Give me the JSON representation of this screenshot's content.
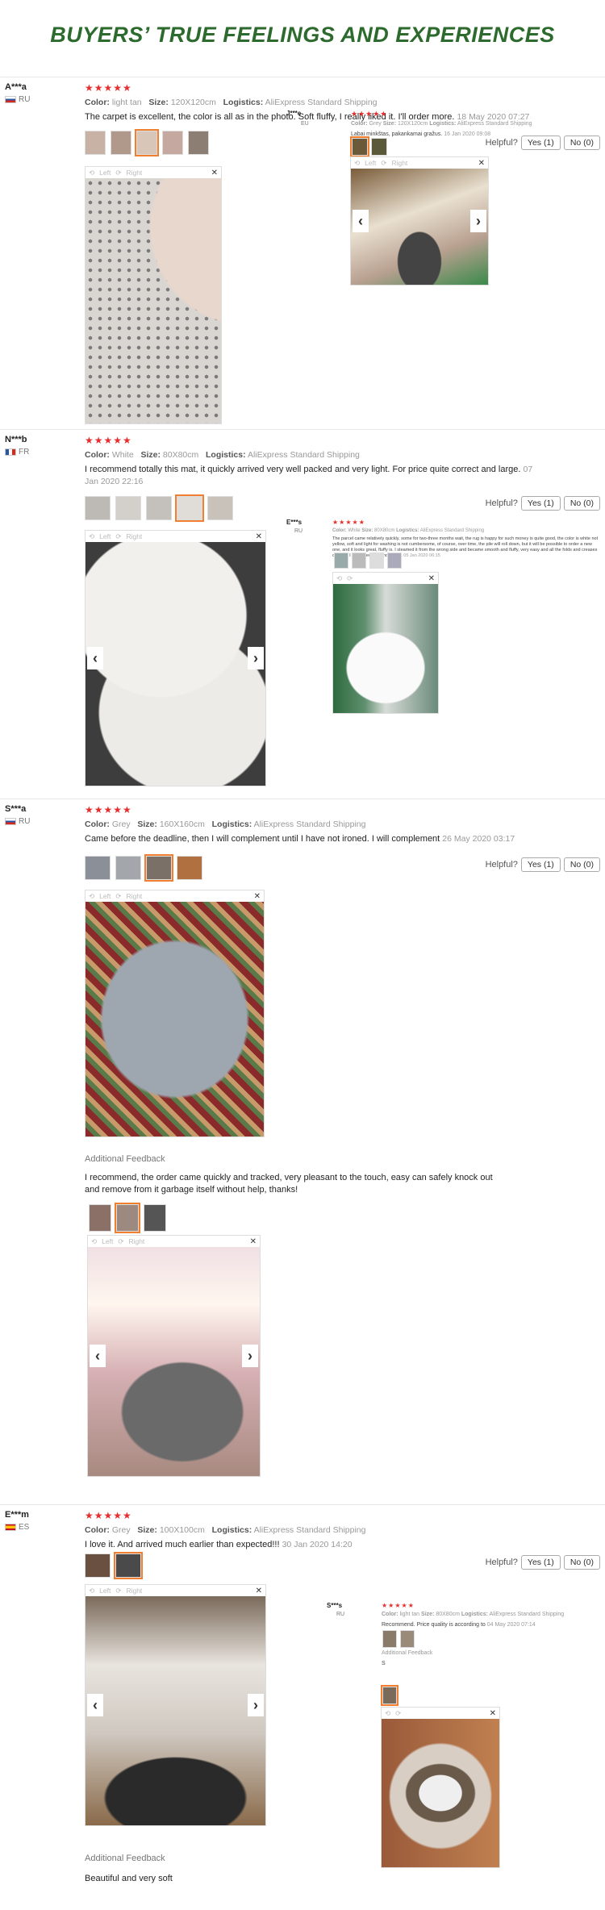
{
  "heading": "BUYERS’ TRUE FEELINGS AND EXPERIENCES",
  "labels": {
    "color": "Color:",
    "size": "Size:",
    "logistics": "Logistics:",
    "helpful": "Helpful?",
    "yes": "Yes (1)",
    "no": "No (0)",
    "left": "Left",
    "right": "Right",
    "additional": "Additional Feedback",
    "stars": "★★★★★"
  },
  "reviews": [
    {
      "user": "A***a",
      "country": "RU",
      "color": "light tan",
      "size": "120X120cm",
      "logistics": "AliExpress Standard Shipping",
      "text": "The carpet is excellent, the color is all as in the photo. Soft fluffy, I really liked it. I'll order more.",
      "date": "18 May 2020 07:27"
    },
    {
      "user": "N***b",
      "country": "FR",
      "color": "White",
      "size": "80X80cm",
      "logistics": "AliExpress Standard Shipping",
      "text": "I recommend totally this mat, it quickly arrived very well packed and very light. For price quite correct and large.",
      "date": "07 Jan 2020 22:16"
    },
    {
      "user": "S***a",
      "country": "RU",
      "color": "Grey",
      "size": "160X160cm",
      "logistics": "AliExpress Standard Shipping",
      "text": "Came before the deadline, then I will complement until I have not ironed. I will complement",
      "date": "26 May 2020 03:17",
      "additional": "I recommend, the order came quickly and tracked, very pleasant to the touch, easy can safely knock out and remove from it garbage itself without help, thanks!"
    },
    {
      "user": "E***m",
      "country": "ES",
      "color": "Grey",
      "size": "100X100cm",
      "logistics": "AliExpress Standard Shipping",
      "text": "I love it. And arrived much earlier than expected!!!",
      "date": "30 Jan 2020 14:20",
      "additional": "Beautiful and very soft"
    }
  ],
  "side": [
    {
      "user": "J***e",
      "country": "EU",
      "color": "Grey",
      "size": "120X120cm",
      "logistics": "AliExpress Standard Shipping",
      "text": "Labai minkštas, pakankamai gražus.",
      "date": "16 Jan 2020 09:08"
    },
    {
      "user": "E***s",
      "country": "RU",
      "color": "White",
      "size": "80X80cm",
      "logistics": "AliExpress Standard Shipping",
      "text": "The parcel came relatively quickly, some for two-three months wait, the rug is happy for such money is quite good, the color is white not yellow, soft and light for washing is not cumbersome, of course, over time, the pile will roll down, but it will be possible to order a new one, and it looks great, fluffy is. I steamed it from the wrong side and became smooth and fluffy, very easy and all the folds and creases cleared, I highly recommend to buy.",
      "date": "05 Jan 2020 06:15"
    },
    {
      "user": "S***s",
      "country": "RU",
      "color": "light tan",
      "size": "80X80cm",
      "logistics": "AliExpress Standard Shipping",
      "text": "Recommend. Price quality is according to",
      "date": "04 May 2020 07:14",
      "additional": "S"
    }
  ]
}
